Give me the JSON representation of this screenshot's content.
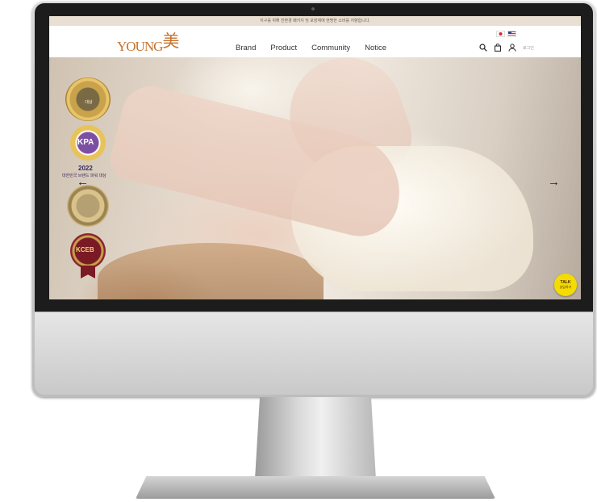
{
  "notice": {
    "text": "지구를 위해 친환경 패키지 및 포장재에 현명한 소비를 지향합니다."
  },
  "header": {
    "logo_text": "YOUNG",
    "logo_mark": "美",
    "nav": [
      "Brand",
      "Product",
      "Community",
      "Notice"
    ],
    "login_label": "로그인",
    "flags": [
      "kr-flag-icon",
      "us-flag-icon"
    ],
    "icons": [
      "search-icon",
      "cart-icon",
      "user-icon"
    ]
  },
  "hero": {
    "prev_arrow": "←",
    "next_arrow": "→",
    "badges": {
      "badge1": "대상",
      "badge2_logo": "KPA",
      "badge2_year": "2022",
      "badge2_caption": "대한민국 브랜드 파워 대상",
      "badge4_logo": "KCEB"
    }
  },
  "talk": {
    "icon_text": "TALK",
    "label": "상담하기"
  },
  "colors": {
    "accent": "#c6732e",
    "notice_bg": "#e9dfd2",
    "talk_yellow": "#f5dc00"
  }
}
